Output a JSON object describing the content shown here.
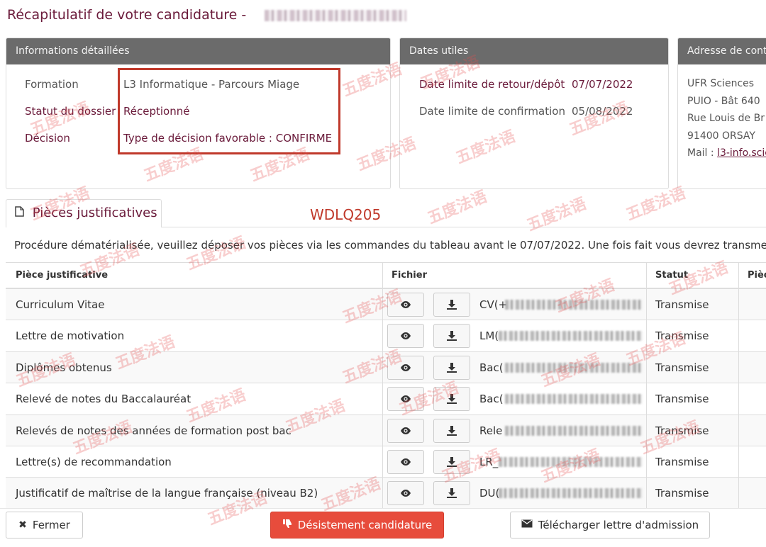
{
  "page": {
    "title": "Récapitulatif de votre candidature -"
  },
  "panels": {
    "details": {
      "header": "Informations détaillées",
      "rows": [
        {
          "label": "Formation",
          "value": "L3 Informatique - Parcours Miage"
        },
        {
          "label": "Statut du dossier",
          "value": "Réceptionné"
        },
        {
          "label": "Décision",
          "value": "Type de décision favorable : CONFIRME"
        }
      ]
    },
    "dates": {
      "header": "Dates utiles",
      "rows": [
        {
          "label": "Date limite de retour/dépôt",
          "value": "07/07/2022"
        },
        {
          "label": "Date limite de confirmation",
          "value": "05/08/2022"
        }
      ]
    },
    "contact": {
      "header": "Adresse de cont",
      "lines": [
        "UFR Sciences",
        "PUIO - Bât 640",
        "Rue Louis de Br",
        "91400 ORSAY"
      ],
      "mail_label": "Mail :",
      "mail_link": "l3-info.scie"
    }
  },
  "annotation": {
    "highlight_color": "#c0392b",
    "code": "WDLQ205"
  },
  "tab": {
    "label": "Pièces justificatives",
    "icon": "document-icon"
  },
  "procedure_text": "Procédure dématérialisée, veuillez déposer vos pièces via les commandes du tableau avant le 07/07/2022. Une fois fait vous devrez transmettre",
  "table": {
    "headers": {
      "piece": "Pièce justificative",
      "fichier": "Fichier",
      "statut": "Statut",
      "piece2": "Pièc"
    },
    "rows": [
      {
        "piece": "Curriculum Vitae",
        "file_prefix": "CV(+",
        "status": "Transmise"
      },
      {
        "piece": "Lettre de motivation",
        "file_prefix": "LM(",
        "status": "Transmise"
      },
      {
        "piece": "Diplômes obtenus",
        "file_prefix": "Bac(",
        "status": "Transmise"
      },
      {
        "piece": "Relevé de notes du Baccalauréat",
        "file_prefix": "Bac(",
        "status": "Transmise"
      },
      {
        "piece": "Relevés de notes des années de formation post bac",
        "file_prefix": "Rele",
        "status": "Transmise"
      },
      {
        "piece": "Lettre(s) de recommandation",
        "file_prefix": "LR_",
        "status": "Transmise"
      },
      {
        "piece": "Justificatif de maîtrise de la langue française (niveau B2)",
        "file_prefix": "DU(",
        "status": "Transmise"
      }
    ]
  },
  "actions": {
    "close": "Fermer",
    "withdraw": "Désistement candidature",
    "download_letter": "Télécharger lettre d'admission"
  },
  "watermark": "五度法语",
  "colors": {
    "accent": "#6a1a3a",
    "panel_header": "#6b6b6b",
    "danger": "#e74c3c"
  }
}
